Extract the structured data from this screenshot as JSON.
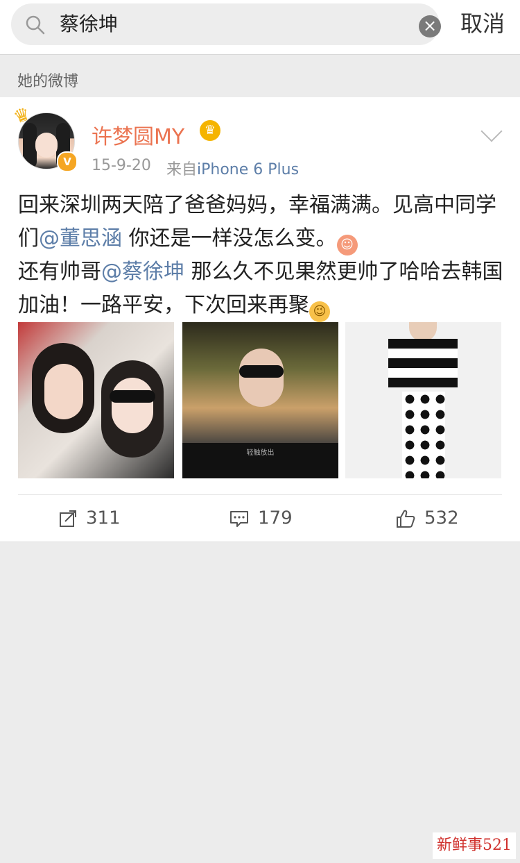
{
  "search": {
    "query": "蔡徐坤",
    "cancel_label": "取消"
  },
  "section": {
    "title": "她的微博"
  },
  "post": {
    "user_name": "许梦圆MY",
    "time": "15-9-20",
    "source_prefix": "来自",
    "source_device": "iPhone 6 Plus",
    "text": {
      "part1": "回来深圳两天陪了爸爸妈妈，幸福满满。见高中同学们",
      "mention1": "@董思涵",
      "part2": " 你还是一样没怎么变。",
      "part3": "还有帅哥",
      "mention2": "@蔡徐坤",
      "part4": " 那么久不见果然更帅了哈哈去韩国加油！一路平安，下次回来再聚"
    },
    "image_caption": "轻触放出",
    "images": [
      "photo-selfie",
      "photo-heart-hands",
      "photo-fashion"
    ],
    "actions": {
      "repost_count": "311",
      "comment_count": "179",
      "like_count": "532"
    }
  },
  "watermark": "新鲜事521",
  "colors": {
    "accent_name": "#eb7350",
    "link": "#5d7ea8",
    "background": "#ececec"
  }
}
